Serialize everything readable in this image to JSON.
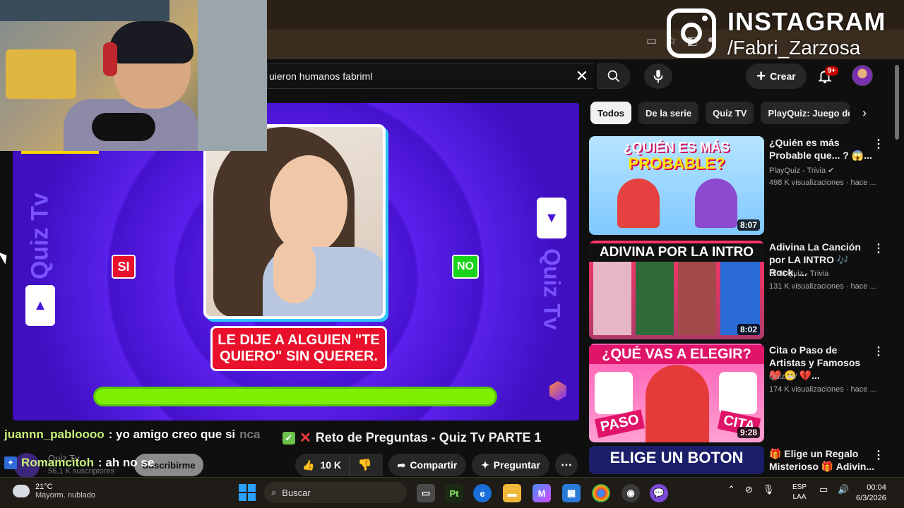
{
  "overlay": {
    "instagram_title": "INSTAGRAM",
    "instagram_handle": "/Fabri_Zarzosa"
  },
  "header": {
    "search_value": "uieron humanos fabriml",
    "create_label": "Crear",
    "notifications_badge": "9+"
  },
  "video": {
    "left_brand": "Quiz Tv",
    "right_brand": "Quiz Tv",
    "si_label": "SI",
    "no_label": "NO",
    "question": "LE DIJE A ALGUIEN \"TE QUIERO\" SIN QUERER.",
    "title": "Reto de Preguntas - Quiz Tv PARTE 1",
    "timer_progress": 1.0
  },
  "actions": {
    "likes": "10 K",
    "share": "Compartir",
    "ask": "Preguntar"
  },
  "channel": {
    "name": "Quiz Tv",
    "subs": "56,1 K suscriptores",
    "subscribe": "Suscribirme"
  },
  "chat": [
    {
      "user": "juannn_pabloooo",
      "msg": ": yo amigo creo que si",
      "faded": "nca"
    },
    {
      "user": "Romamcitoh",
      "msg": ": ah no se"
    }
  ],
  "chips": [
    {
      "label": "Todos",
      "active": true
    },
    {
      "label": "De la serie",
      "active": false
    },
    {
      "label": "Quiz TV",
      "active": false
    },
    {
      "label": "PlayQuiz: Juego de",
      "active": false
    }
  ],
  "recommendations": [
    {
      "thumb_text_top": "¿QUIÉN ES MÁS",
      "thumb_text_bottom": "PROBABLE?",
      "duration": "8:07",
      "title": "¿Quién es más Probable que... ? 😱...",
      "channel": "PlayQuiz - Trivia",
      "meta": "498 K visualizaciones · hace ..."
    },
    {
      "thumb_text_top": "ADIVINA POR LA INTRO",
      "duration": "8:02",
      "title": "Adivina La Canción por LA INTRO 🎶 Rock, ...",
      "channel": "Club Quiz - Trivia",
      "meta": "131 K visualizaciones · hace ..."
    },
    {
      "thumb_text_top": "¿QUÉ VAS A ELEGIR?",
      "thumb_label_a": "PASO",
      "thumb_label_b": "CITA",
      "duration": "9:28",
      "title": "Cita o Paso de Artistas y Famosos ❤️ 😬 💔...",
      "channel": "Quiz TV",
      "meta": "174 K visualizaciones · hace ..."
    },
    {
      "thumb_text_top": "ELIGE UN BOTON",
      "title": "🎁 Elige un Regalo Misterioso 🎁 Adivin..."
    }
  ],
  "taskbar": {
    "weather_temp": "21°C",
    "weather_desc": "Mayorm. nublado",
    "search": "Buscar",
    "lang1": "ESP",
    "lang2": "LAA",
    "time": "00:04",
    "date": "6/3/2026"
  },
  "colors": {
    "accent_purple": "#4a14d8",
    "si_red": "#e8102a",
    "no_green": "#19d31a",
    "timer_green": "#7cf000"
  }
}
